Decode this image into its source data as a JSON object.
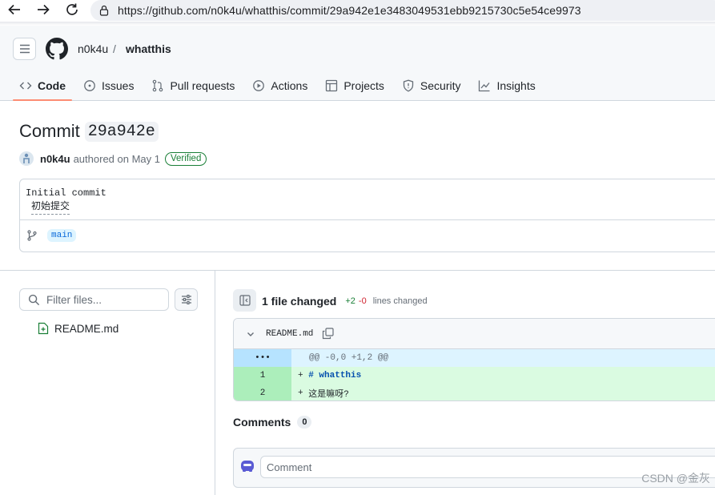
{
  "browser": {
    "url": "https://github.com/n0k4u/whatthis/commit/29a942e1e3483049531ebb9215730c5e54ce9973"
  },
  "header": {
    "owner": "n0k4u",
    "separator": "/",
    "repo": "whatthis"
  },
  "tabs": [
    {
      "label": "Code",
      "icon": "code-icon",
      "active": true
    },
    {
      "label": "Issues",
      "icon": "issue-icon"
    },
    {
      "label": "Pull requests",
      "icon": "pull-request-icon"
    },
    {
      "label": "Actions",
      "icon": "play-icon"
    },
    {
      "label": "Projects",
      "icon": "table-icon"
    },
    {
      "label": "Security",
      "icon": "shield-icon"
    },
    {
      "label": "Insights",
      "icon": "graph-icon"
    }
  ],
  "commit": {
    "title_prefix": "Commit",
    "sha_short": "29a942e",
    "author": "n0k4u",
    "authored_text": "authored on May 1",
    "verified_label": "Verified",
    "message_line1": "Initial commit",
    "message_line2": "初始提交",
    "branch": "main"
  },
  "file_tree": {
    "filter_placeholder": "Filter files...",
    "files": [
      "README.md"
    ]
  },
  "diff_summary": {
    "files_changed": "1 file changed",
    "additions": "+2",
    "deletions": "-0",
    "lines_changed": "lines changed"
  },
  "diff": {
    "filename": "README.md",
    "hunk_marker": "•••",
    "hunk_header": "@@ -0,0 +1,2 @@",
    "lines": [
      {
        "num": "1",
        "prefix": "+",
        "content": "# whatthis"
      },
      {
        "num": "2",
        "prefix": "+",
        "content": "这是嘛呀?"
      }
    ]
  },
  "comments": {
    "title": "Comments",
    "count": "0",
    "placeholder": "Comment"
  },
  "watermark": "CSDN @金灰",
  "colors": {
    "accent_tab": "#fd8c73",
    "verified": "#1a7f37",
    "addition": "#1a7f37",
    "deletion": "#cf222e",
    "link": "#0969da"
  }
}
